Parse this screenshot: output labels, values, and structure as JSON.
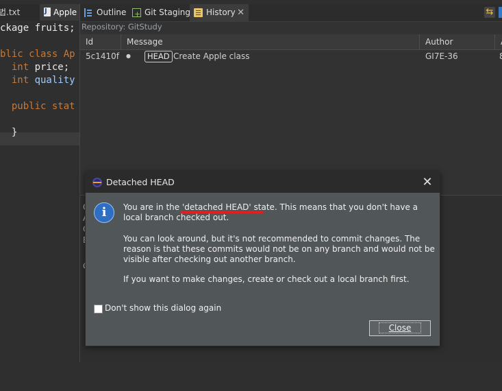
{
  "editor": {
    "tabs": [
      {
        "label": "법.txt"
      },
      {
        "label": "Apple"
      }
    ],
    "code_lines": [
      {
        "kw": "",
        "text": "ckage fruits;"
      },
      {
        "kw": "blic class ",
        "text": "Ap"
      },
      {
        "kw": "  int ",
        "text": "price;"
      },
      {
        "kw": "  int ",
        "text": "quality"
      },
      {
        "kw": "  public stat",
        "text": ""
      },
      {
        "kw": "",
        "text": "  }"
      }
    ]
  },
  "views": {
    "tabs": {
      "outline": "Outline",
      "staging": "Git Staging",
      "history": "History"
    },
    "repository_label": "Repository: GitStudy",
    "table": {
      "headers": {
        "id": "Id",
        "message": "Message",
        "author": "Author",
        "extra": "A"
      },
      "rows": [
        {
          "id": "5c1410f",
          "ref": "HEAD",
          "message": "Create Apple class",
          "author": "GI7E-36",
          "extra": "8"
        }
      ]
    },
    "lower_pane_peek": [
      "C",
      "A",
      "C",
      "E",
      "C"
    ]
  },
  "dialog": {
    "title": "Detached HEAD",
    "para1": "You are in the 'detached HEAD' state. This means that you don't have a local branch checked out.",
    "para2": "You can look around, but it's not recommended to commit changes. The reason is that these commits would not be on any branch and would not be visible after checking out another branch.",
    "para3": "If you want to make changes, create or check out a local branch first.",
    "checkbox_label": "Don't show this dialog again",
    "checkbox_checked": false,
    "close_button": "Close"
  },
  "colors": {
    "keyword": "#cc7832",
    "dialog_bg": "#515658",
    "info_icon": "#2e6fc4",
    "annotation_underline": "#e02020"
  }
}
